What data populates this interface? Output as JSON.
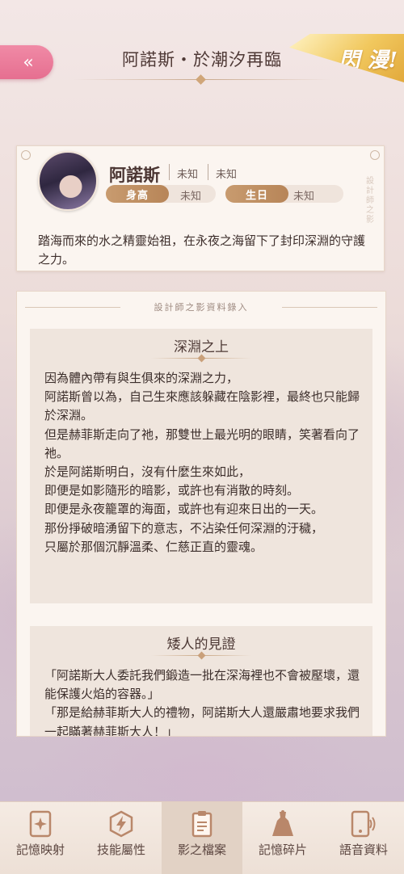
{
  "header": {
    "back_icon": "«",
    "title": "阿諾斯・於潮汐再臨",
    "badge": "閃 漫!"
  },
  "profile": {
    "name": "阿諾斯",
    "meta1": "未知",
    "meta2": "未知",
    "height_label": "身高",
    "height_value": "未知",
    "birthday_label": "生日",
    "birthday_value": "未知",
    "vertical_deco": "設計師之影",
    "description": "踏海而來的水之精靈始祖，在永夜之海留下了封印深淵的守護之力。"
  },
  "records": {
    "header": "設計師之影資料錄入",
    "blocks": [
      {
        "title": "深淵之上",
        "lines": [
          "因為體內帶有與生俱來的深淵之力，",
          "阿諾斯曾以為，自己生來應該躲藏在陰影裡，最終也只能歸於深淵。",
          "但是赫菲斯走向了祂，那雙世上最光明的眼睛，笑著看向了祂。",
          "於是阿諾斯明白，沒有什麼生來如此，",
          "即便是如影隨形的暗影，或許也有消散的時刻。",
          "即便是永夜籠罩的海面，或許也有迎來日出的一天。",
          "那份掙破暗湧留下的意志，不沾染任何深淵的汙穢，",
          "只屬於那個沉靜溫柔、仁慈正直的靈魂。"
        ]
      },
      {
        "title": "矮人的見證",
        "lines": [
          "「阿諾斯大人委託我們鍛造一批在深海裡也不會被壓壞，還能保護火焰的容器。」",
          "「那是給赫菲斯大人的禮物，阿諾斯大人還嚴肅地要求我們一起瞞著赫菲斯大人！」"
        ]
      }
    ]
  },
  "nav": {
    "items": [
      {
        "label": "記憶映射",
        "icon": "card-sparkle-icon"
      },
      {
        "label": "技能屬性",
        "icon": "lightning-icon"
      },
      {
        "label": "影之檔案",
        "icon": "document-icon"
      },
      {
        "label": "記憶碎片",
        "icon": "dress-icon"
      },
      {
        "label": "語音資料",
        "icon": "phone-sound-icon"
      }
    ]
  },
  "colors": {
    "accent_pink": "#e66f90",
    "accent_gold": "#c89b6f",
    "panel_bg": "#fbf5f0"
  }
}
